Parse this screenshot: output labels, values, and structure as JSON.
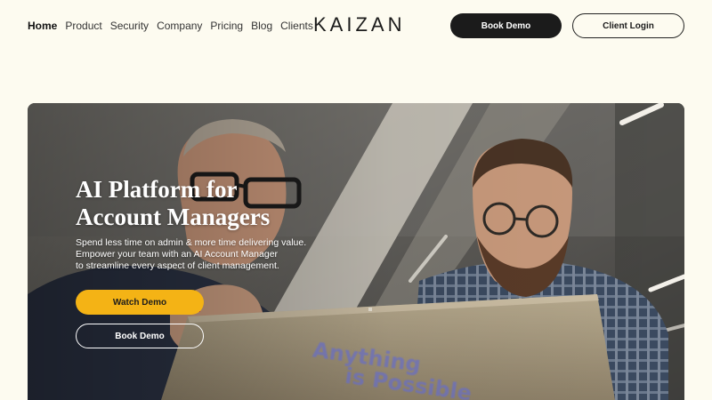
{
  "nav": {
    "items": [
      {
        "label": "Home",
        "active": true
      },
      {
        "label": "Product"
      },
      {
        "label": "Security"
      },
      {
        "label": "Company"
      },
      {
        "label": "Pricing"
      },
      {
        "label": "Blog"
      },
      {
        "label": "Clients"
      }
    ]
  },
  "brand": {
    "name": "KAIZAN"
  },
  "header": {
    "book_demo": "Book Demo",
    "client_login": "Client Login"
  },
  "hero": {
    "title_line1": "AI Platform for",
    "title_line2": "Account Managers",
    "subtitle_lines": [
      "Spend less time on admin & more time delivering value.",
      "Empower your team with an AI Account Manager",
      "to streamline every aspect of client management."
    ],
    "watch_demo": "Watch Demo",
    "book_demo": "Book Demo",
    "laptop_sticker": [
      "Anything",
      "is Possible"
    ]
  },
  "colors": {
    "page_bg": "#fdfbf0",
    "dark": "#1b1b1b",
    "accent": "#f4b315"
  }
}
